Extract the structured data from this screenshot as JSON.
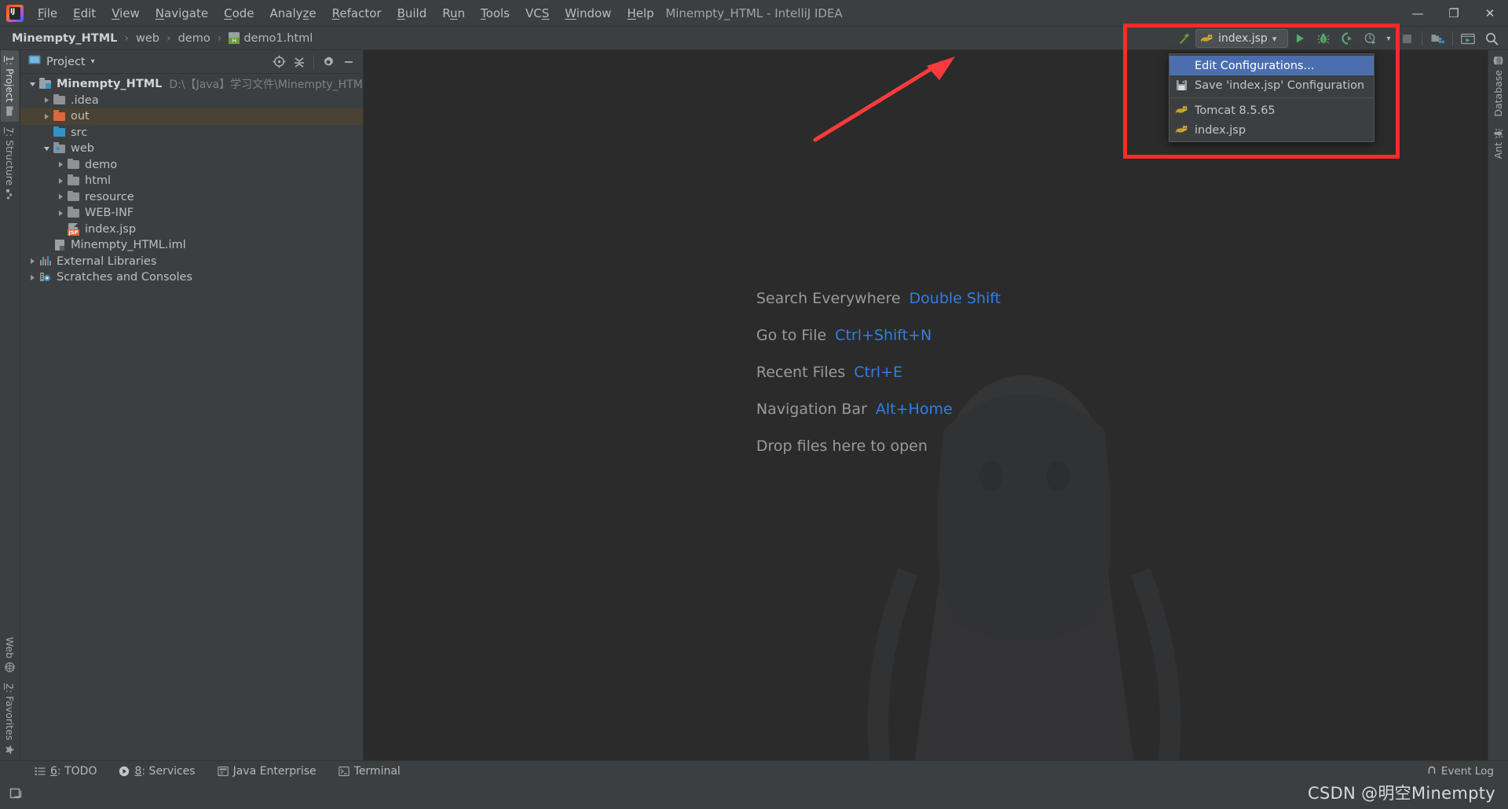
{
  "window": {
    "title": "Minempty_HTML - IntelliJ IDEA",
    "minimize": "—",
    "maximize": "❐",
    "close": "✕"
  },
  "menubar": {
    "logo_text": "IJ",
    "items": [
      {
        "label": "File",
        "mnemonic": "F"
      },
      {
        "label": "Edit",
        "mnemonic": "E"
      },
      {
        "label": "View",
        "mnemonic": "V"
      },
      {
        "label": "Navigate",
        "mnemonic": "N"
      },
      {
        "label": "Code",
        "mnemonic": "C"
      },
      {
        "label": "Analyze",
        "mnemonic": "z"
      },
      {
        "label": "Refactor",
        "mnemonic": "R"
      },
      {
        "label": "Build",
        "mnemonic": "B"
      },
      {
        "label": "Run",
        "mnemonic": "u"
      },
      {
        "label": "Tools",
        "mnemonic": "T"
      },
      {
        "label": "VCS",
        "mnemonic": "S"
      },
      {
        "label": "Window",
        "mnemonic": "W"
      },
      {
        "label": "Help",
        "mnemonic": "H"
      }
    ]
  },
  "breadcrumb": {
    "separator": "›",
    "items": [
      {
        "label": "Minempty_HTML",
        "icon": "none"
      },
      {
        "label": "web",
        "icon": "none"
      },
      {
        "label": "demo",
        "icon": "none"
      },
      {
        "label": "demo1.html",
        "icon": "html-file-icon"
      }
    ]
  },
  "toolbar": {
    "build_icon": "hammer-icon",
    "run_config": {
      "icon": "tomcat-cat-icon",
      "label": "index.jsp",
      "chevron": "▾"
    },
    "run_icon": "run-play-icon",
    "debug_icon": "debug-bug-icon",
    "coverage_icon": "run-with-coverage-icon",
    "profiler_icon": "profiler-icon",
    "profiler_chevron": "▾",
    "stop_icon": "stop-icon",
    "project_structure_icon": "project-structure-icon",
    "updates_icon": "updates-icon",
    "search_icon": "search-icon"
  },
  "run_config_menu": {
    "items": [
      {
        "label": "Edit Configurations...",
        "icon": "none",
        "selected": true
      },
      {
        "label": "Save 'index.jsp' Configuration",
        "icon": "save-floppy-icon",
        "selected": false
      },
      {
        "label": "Tomcat 8.5.65",
        "icon": "tomcat-cat-icon",
        "selected": false
      },
      {
        "label": "index.jsp",
        "icon": "tomcat-cat-icon",
        "selected": false
      }
    ]
  },
  "left_stripe": {
    "top": [
      {
        "label": "1: Project",
        "mnemonic": "1",
        "icon": "project-folder-icon",
        "active": true
      },
      {
        "label": "7: Structure",
        "mnemonic": "7",
        "icon": "structure-icon",
        "active": false
      }
    ],
    "bottom": [
      {
        "label": "Web",
        "icon": "web-globe-icon",
        "active": false
      },
      {
        "label": "2: Favorites",
        "mnemonic": "2",
        "icon": "star-icon",
        "active": false
      }
    ]
  },
  "right_stripe": {
    "items": [
      {
        "label": "Database",
        "icon": "database-icon",
        "active": false
      },
      {
        "label": "Ant",
        "icon": "ant-bug-icon",
        "active": false
      }
    ]
  },
  "project_panel": {
    "title": "Project",
    "title_icon": "project-icon",
    "title_chevron": "▾",
    "actions": [
      {
        "name": "scroll-from-source-icon",
        "glyph": "target"
      },
      {
        "name": "collapse-all-icon",
        "glyph": "collapse"
      },
      {
        "name": "settings-gear-icon",
        "glyph": "gear"
      },
      {
        "name": "hide-panel-icon",
        "glyph": "minus"
      }
    ],
    "tree": [
      {
        "label": "Minempty_HTML",
        "path": "D:\\【Java】学习文件\\Minempty_HTML",
        "indent": 0,
        "arrow": "down",
        "icon": "module-folder-icon",
        "bold": true,
        "selected": false
      },
      {
        "label": ".idea",
        "path": "",
        "indent": 1,
        "arrow": "right",
        "icon": "folder-grey-icon",
        "bold": false,
        "selected": false
      },
      {
        "label": "out",
        "path": "",
        "indent": 1,
        "arrow": "right",
        "icon": "folder-orange-icon",
        "bold": false,
        "selected": true
      },
      {
        "label": "src",
        "path": "",
        "indent": 1,
        "arrow": "none",
        "icon": "folder-source-icon",
        "bold": false,
        "selected": false
      },
      {
        "label": "web",
        "path": "",
        "indent": 1,
        "arrow": "down",
        "icon": "folder-web-icon",
        "bold": false,
        "selected": false
      },
      {
        "label": "demo",
        "path": "",
        "indent": 2,
        "arrow": "right",
        "icon": "folder-grey-icon",
        "bold": false,
        "selected": false
      },
      {
        "label": "html",
        "path": "",
        "indent": 2,
        "arrow": "right",
        "icon": "folder-grey-icon",
        "bold": false,
        "selected": false
      },
      {
        "label": "resource",
        "path": "",
        "indent": 2,
        "arrow": "right",
        "icon": "folder-grey-icon",
        "bold": false,
        "selected": false
      },
      {
        "label": "WEB-INF",
        "path": "",
        "indent": 2,
        "arrow": "right",
        "icon": "folder-grey-icon",
        "bold": false,
        "selected": false
      },
      {
        "label": "index.jsp",
        "path": "",
        "indent": 2,
        "arrow": "none",
        "icon": "jsp-file-icon",
        "bold": false,
        "selected": false
      },
      {
        "label": "Minempty_HTML.iml",
        "path": "",
        "indent": 1,
        "arrow": "none",
        "icon": "iml-file-icon",
        "bold": false,
        "selected": false
      },
      {
        "label": "External Libraries",
        "path": "",
        "indent": 0,
        "arrow": "right",
        "icon": "libraries-icon",
        "bold": false,
        "selected": false
      },
      {
        "label": "Scratches and Consoles",
        "path": "",
        "indent": 0,
        "arrow": "right",
        "icon": "scratches-icon",
        "bold": false,
        "selected": false
      }
    ]
  },
  "editor": {
    "shortcuts": [
      {
        "name": "Search Everywhere",
        "key": "Double Shift"
      },
      {
        "name": "Go to File",
        "key": "Ctrl+Shift+N"
      },
      {
        "name": "Recent Files",
        "key": "Ctrl+E"
      },
      {
        "name": "Navigation Bar",
        "key": "Alt+Home"
      },
      {
        "name": "Drop files here to open",
        "key": ""
      }
    ]
  },
  "bottom_bar": {
    "items": [
      {
        "label": "6: TODO",
        "mnemonic": "6",
        "icon": "todo-list-icon"
      },
      {
        "label": "8: Services",
        "mnemonic": "8",
        "icon": "services-play-icon"
      },
      {
        "label": "Java Enterprise",
        "mnemonic": "",
        "icon": "java-enterprise-icon"
      },
      {
        "label": "Terminal",
        "mnemonic": "",
        "icon": "terminal-icon"
      }
    ],
    "event_log": {
      "label": "Event Log",
      "icon": "event-log-icon"
    }
  },
  "status_bar": {
    "layout_icon": "layout-icon",
    "watermark": "CSDN @明空Minempty"
  },
  "colors": {
    "accent_blue": "#4b6eaf",
    "link_blue": "#2f7fe8",
    "annotation_red": "#ff2a2a",
    "selection_amber": "#4a4333",
    "editor_bg": "#2b2b2b",
    "chrome_bg": "#3c3f41"
  }
}
